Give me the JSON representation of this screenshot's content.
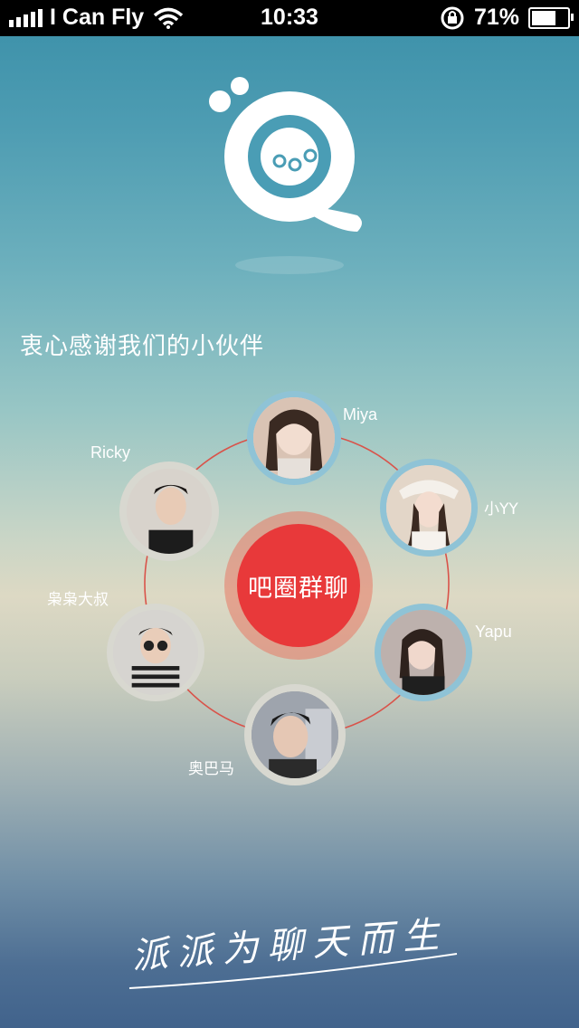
{
  "status_bar": {
    "carrier": "I Can Fly",
    "time": "10:33",
    "battery_percent": "71%",
    "battery_level": 0.71
  },
  "logo": {
    "icon": "app-logo-q-bubble"
  },
  "thanks_text": "衷心感谢我们的小伙伴",
  "center_button": {
    "label": "吧圈群聊",
    "color": "#e8393a"
  },
  "partners": [
    {
      "name": "Miya"
    },
    {
      "name": "小YY"
    },
    {
      "name": "Yapu"
    },
    {
      "name": "奥巴马"
    },
    {
      "name": "枭枭大叔"
    },
    {
      "name": "Ricky"
    }
  ],
  "slogan": "派派为聊天而生",
  "colors": {
    "ring": "#d9534a",
    "avatar_border_blue": "#8fc3d6",
    "avatar_border_light": "#d8d8d0"
  }
}
